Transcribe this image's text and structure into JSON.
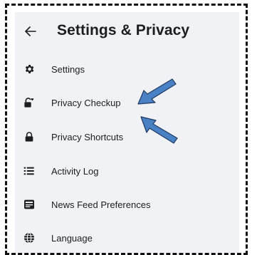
{
  "header": {
    "title": "Settings & Privacy",
    "back_icon": "arrow-left-icon"
  },
  "menu": {
    "items": [
      {
        "label": "Settings",
        "icon": "gear-icon"
      },
      {
        "label": "Privacy Checkup",
        "icon": "lock-heart-icon"
      },
      {
        "label": "Privacy Shortcuts",
        "icon": "lock-icon"
      },
      {
        "label": "Activity Log",
        "icon": "list-icon"
      },
      {
        "label": "News Feed Preferences",
        "icon": "feed-icon"
      },
      {
        "label": "Language",
        "icon": "globe-icon"
      }
    ]
  },
  "annotations": {
    "arrow_color": "#4a80c4",
    "arrow_outline": "#1f3b63",
    "points_to": [
      "Privacy Checkup",
      "Privacy Shortcuts"
    ]
  }
}
